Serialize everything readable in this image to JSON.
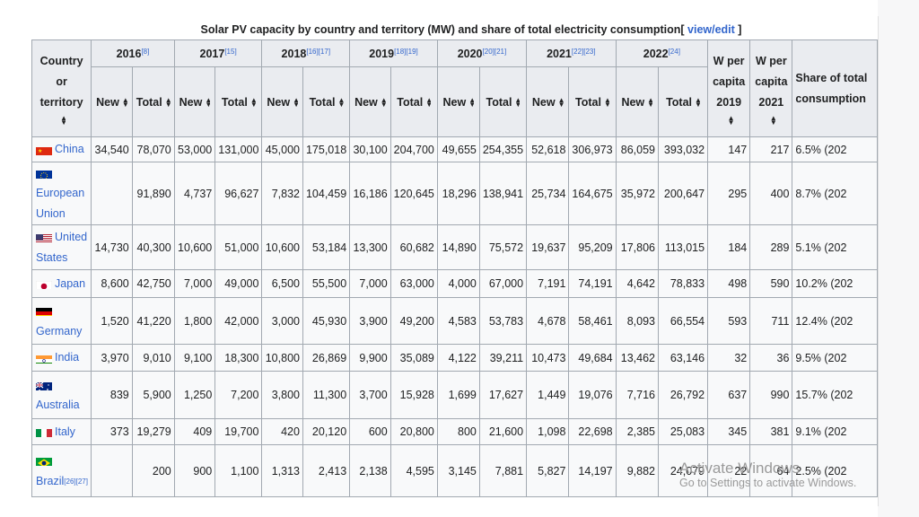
{
  "caption": {
    "text": "Solar PV capacity by country and territory (MW) and share of total electricity consumption[",
    "link": "view/edit",
    "end": "]"
  },
  "header": {
    "country": "Country or territory",
    "years": [
      {
        "year": "2016",
        "ref": "[8]"
      },
      {
        "year": "2017",
        "ref": "[15]"
      },
      {
        "year": "2018",
        "ref": "[16][17]"
      },
      {
        "year": "2019",
        "ref": "[18][19]"
      },
      {
        "year": "2020",
        "ref": "[20][21]"
      },
      {
        "year": "2021",
        "ref": "[22][23]"
      },
      {
        "year": "2022",
        "ref": "[24]"
      }
    ],
    "new": "New",
    "total": "Total",
    "wpc2019": "W per capita 2019",
    "wpc2021": "W per capita 2021",
    "share": "Share of total consumption"
  },
  "rows": [
    {
      "name": "China",
      "flag": "china",
      "ref": "",
      "vals": [
        "34,540",
        "78,070",
        "53,000",
        "131,000",
        "45,000",
        "175,018",
        "30,100",
        "204,700",
        "49,655",
        "254,355",
        "52,618",
        "306,973",
        "86,059",
        "393,032",
        "147",
        "217",
        "6.5% (202"
      ]
    },
    {
      "name": "European Union",
      "flag": "eu",
      "ref": "",
      "vals": [
        "",
        "91,890",
        "4,737",
        "96,627",
        "7,832",
        "104,459",
        "16,186",
        "120,645",
        "18,296",
        "138,941",
        "25,734",
        "164,675",
        "35,972",
        "200,647",
        "295",
        "400",
        "8.7% (202"
      ]
    },
    {
      "name": "United States",
      "flag": "us",
      "ref": "",
      "vals": [
        "14,730",
        "40,300",
        "10,600",
        "51,000",
        "10,600",
        "53,184",
        "13,300",
        "60,682",
        "14,890",
        "75,572",
        "19,637",
        "95,209",
        "17,806",
        "113,015",
        "184",
        "289",
        "5.1% (202"
      ]
    },
    {
      "name": "Japan",
      "flag": "japan",
      "ref": "",
      "vals": [
        "8,600",
        "42,750",
        "7,000",
        "49,000",
        "6,500",
        "55,500",
        "7,000",
        "63,000",
        "4,000",
        "67,000",
        "7,191",
        "74,191",
        "4,642",
        "78,833",
        "498",
        "590",
        "10.2% (202"
      ]
    },
    {
      "name": "Germany",
      "flag": "germany",
      "ref": "",
      "vals": [
        "1,520",
        "41,220",
        "1,800",
        "42,000",
        "3,000",
        "45,930",
        "3,900",
        "49,200",
        "4,583",
        "53,783",
        "4,678",
        "58,461",
        "8,093",
        "66,554",
        "593",
        "711",
        "12.4% (202"
      ]
    },
    {
      "name": "India",
      "flag": "india",
      "ref": "",
      "vals": [
        "3,970",
        "9,010",
        "9,100",
        "18,300",
        "10,800",
        "26,869",
        "9,900",
        "35,089",
        "4,122",
        "39,211",
        "10,473",
        "49,684",
        "13,462",
        "63,146",
        "32",
        "36",
        "9.5% (202"
      ]
    },
    {
      "name": "Australia",
      "flag": "australia",
      "ref": "",
      "vals": [
        "839",
        "5,900",
        "1,250",
        "7,200",
        "3,800",
        "11,300",
        "3,700",
        "15,928",
        "1,699",
        "17,627",
        "1,449",
        "19,076",
        "7,716",
        "26,792",
        "637",
        "990",
        "15.7% (202"
      ]
    },
    {
      "name": "Italy",
      "flag": "italy",
      "ref": "",
      "vals": [
        "373",
        "19,279",
        "409",
        "19,700",
        "420",
        "20,120",
        "600",
        "20,800",
        "800",
        "21,600",
        "1,098",
        "22,698",
        "2,385",
        "25,083",
        "345",
        "381",
        "9.1% (202"
      ]
    },
    {
      "name": "Brazil",
      "flag": "brazil",
      "ref": "[26][27]",
      "vals": [
        "",
        "200",
        "900",
        "1,100",
        "1,313",
        "2,413",
        "2,138",
        "4,595",
        "3,145",
        "7,881",
        "5,827",
        "14,197",
        "9,882",
        "24,079",
        "22",
        "64",
        "2.5% (202"
      ]
    }
  ],
  "watermark": {
    "line1": "Activate Windows",
    "line2": "Go to Settings to activate Windows."
  },
  "colors": {
    "link": "#3366cc",
    "header_bg": "#eaecf0",
    "cell_bg": "#f8f9fa",
    "border": "#a2a9b1"
  }
}
